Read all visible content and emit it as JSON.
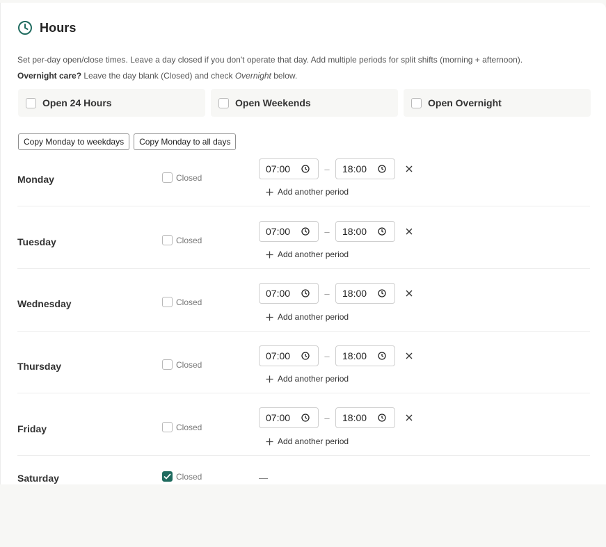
{
  "section": {
    "title": "Hours",
    "icon": "clock-icon",
    "accent_color": "#1f6b5f"
  },
  "description": {
    "line1": "Set per-day open/close times. Leave a day closed if you don't operate that day. Add multiple periods for split shifts (morning + afternoon).",
    "overnight_bold": "Overnight care?",
    "overnight_text_a": " Leave the day blank (Closed) and check ",
    "overnight_italic": "Overnight",
    "overnight_text_b": " below."
  },
  "options": [
    {
      "label": "Open 24 Hours",
      "checked": false
    },
    {
      "label": "Open Weekends",
      "checked": false
    },
    {
      "label": "Open Overnight",
      "checked": false
    }
  ],
  "copy_buttons": {
    "weekdays": "Copy Monday to weekdays",
    "all_days": "Copy Monday to all days"
  },
  "closed_label": "Closed",
  "add_period_label": "Add another period",
  "days": [
    {
      "name": "Monday",
      "closed": false,
      "open": "07:00",
      "close": "18:00"
    },
    {
      "name": "Tuesday",
      "closed": false,
      "open": "07:00",
      "close": "18:00"
    },
    {
      "name": "Wednesday",
      "closed": false,
      "open": "07:00",
      "close": "18:00"
    },
    {
      "name": "Thursday",
      "closed": false,
      "open": "07:00",
      "close": "18:00"
    },
    {
      "name": "Friday",
      "closed": false,
      "open": "07:00",
      "close": "18:00"
    },
    {
      "name": "Saturday",
      "closed": true,
      "open": "",
      "close": "",
      "placeholder": "—"
    }
  ]
}
